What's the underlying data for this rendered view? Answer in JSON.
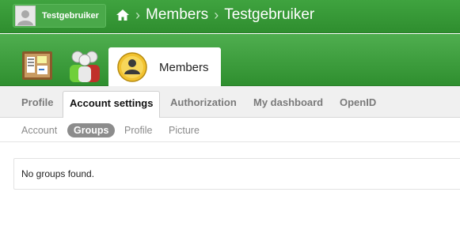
{
  "header": {
    "user_name": "Testgebruiker",
    "breadcrumb": [
      "Members",
      "Testgebruiker"
    ]
  },
  "apps": {
    "active_label": "Members"
  },
  "tabs": [
    {
      "label": "Profile"
    },
    {
      "label": "Account settings"
    },
    {
      "label": "Authorization"
    },
    {
      "label": "My dashboard"
    },
    {
      "label": "OpenID"
    }
  ],
  "subtabs": [
    {
      "label": "Account"
    },
    {
      "label": "Groups"
    },
    {
      "label": "Profile"
    },
    {
      "label": "Picture"
    }
  ],
  "content": {
    "message": "No groups found."
  }
}
